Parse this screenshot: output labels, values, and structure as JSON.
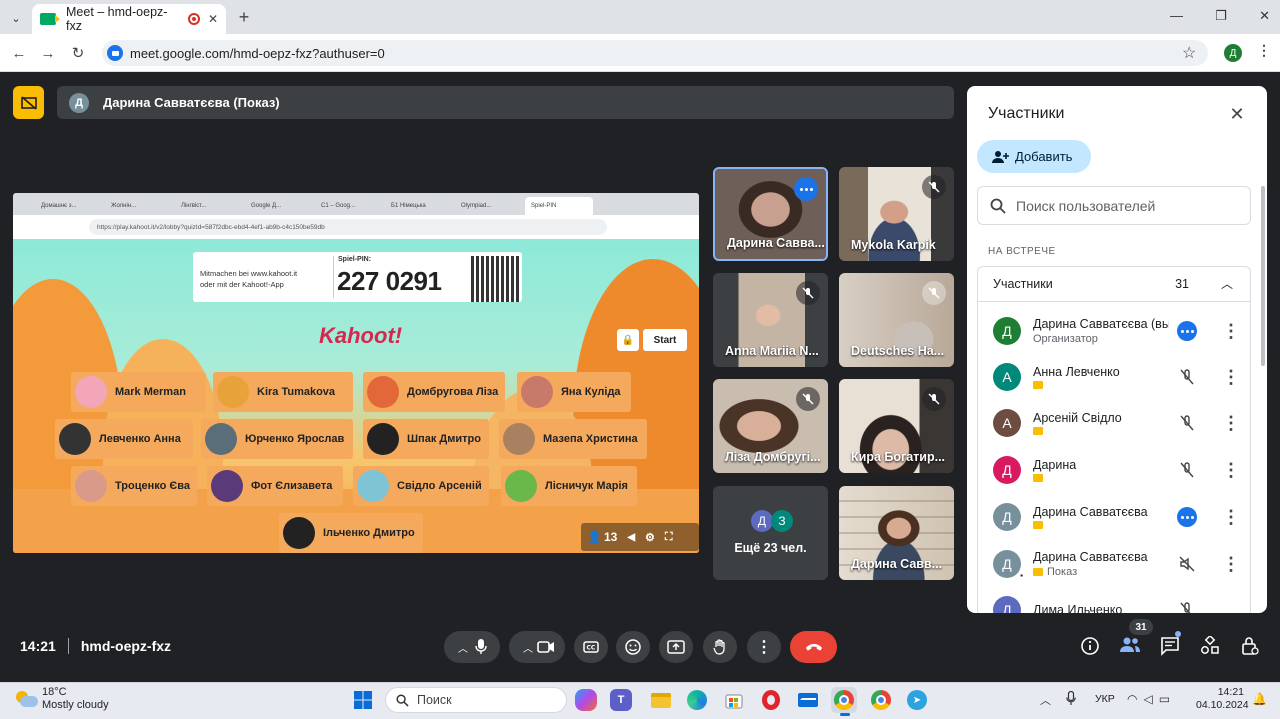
{
  "browser": {
    "tab_title": "Meet – hmd-oepz-fxz",
    "url": "meet.google.com/hmd-oepz-fxz?authuser=0",
    "profile_initial": "Д"
  },
  "presenter": {
    "initial": "Д",
    "label": "Дарина Савватєєва (Показ)"
  },
  "shared_screen": {
    "tabs": [
      "Домашнє з...",
      "Жолнін...",
      "Лінгвіст...",
      "Google Д...",
      "С1 – Goog...",
      "Б1 Німецька",
      "Olympiad...",
      "Spiel-PIN"
    ],
    "url": "https://play.kahoot.it/v2/lobby?quizId=587f2dbc-ebd4-4ef1-ab9b-c4c150be59db",
    "pin_join_line1": "Mitmachen bei www.kahoot.it",
    "pin_join_line2": "oder mit der Kahoot!-App",
    "pin_label": "Spiel-PIN:",
    "pin": "227 0291",
    "logo": "Kahoot!",
    "start_label": "Start",
    "player_count": "13",
    "players": [
      "Mark Merman",
      "Kira Tumakova",
      "Домбругова Ліза",
      "Яна Куліда",
      "Левченко Анна",
      "Юрченко Ярослав",
      "Шпак Дмитро",
      "Мазепа Христина",
      "Троценко Єва",
      "Фот Єлизавета",
      "Свідло Арсеній",
      "Лісничук Марія",
      "Ільченко Дмитро"
    ]
  },
  "tiles": [
    {
      "name": "Дарина Савва..."
    },
    {
      "name": "Mykola Karpik"
    },
    {
      "name": "Anna Mariia N..."
    },
    {
      "name": "Deutsches Ha..."
    },
    {
      "name": "Ліза Домбругі..."
    },
    {
      "name": "Кира Богатир..."
    },
    {
      "name": "Ещё 23 чел.",
      "a1": "Д",
      "a2": "З"
    },
    {
      "name": "Дарина Савв..."
    }
  ],
  "panel": {
    "title": "Участники",
    "add_label": "Добавить",
    "search_placeholder": "Поиск пользователей",
    "section": "НА ВСТРЕЧЕ",
    "group_label": "Участники",
    "group_count": "31",
    "people": [
      {
        "initial": "Д",
        "name": "Дарина Савватєєва (вы)",
        "sub": "Организатор",
        "color": "#1e7e34"
      },
      {
        "initial": "А",
        "name": "Анна Левченко",
        "sub": "",
        "color": "#00897b"
      },
      {
        "initial": "А",
        "name": "Арсеній Свідло",
        "sub": "",
        "color": "#6d4c41"
      },
      {
        "initial": "Д",
        "name": "Дарина",
        "sub": "",
        "color": "#d81b60"
      },
      {
        "initial": "Д",
        "name": "Дарина Савватєєва",
        "sub": "",
        "color": "#78909c"
      },
      {
        "initial": "Д",
        "name": "Дарина Савватєєва",
        "sub": "Показ",
        "color": "#78909c"
      },
      {
        "initial": "Д",
        "name": "Дима Ильченко",
        "sub": "",
        "color": "#5c6bc0"
      }
    ]
  },
  "bottom": {
    "time": "14:21",
    "meeting_code": "hmd-oepz-fxz",
    "people_badge": "31"
  },
  "taskbar": {
    "temp": "18°C",
    "weather": "Mostly cloudy",
    "search_placeholder": "Поиск",
    "lang": "УКР",
    "clock_time": "14:21",
    "clock_date": "04.10.2024"
  }
}
